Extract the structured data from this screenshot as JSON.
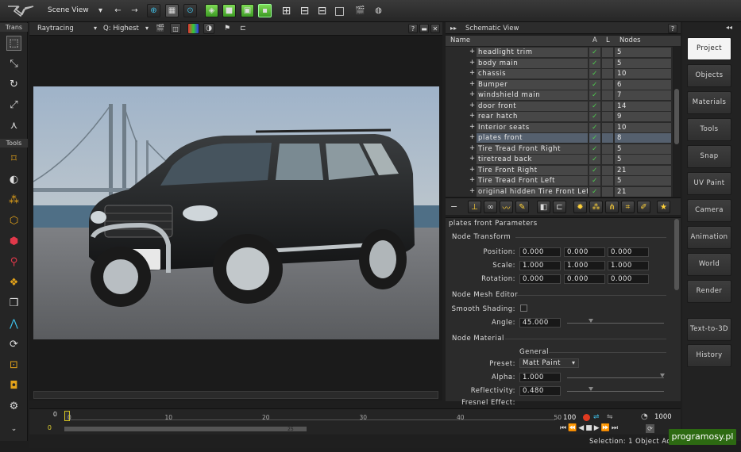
{
  "toolbar": {
    "scene_view": "Scene View"
  },
  "left_panel": {
    "trans_label": "Trans",
    "tools_label": "Tools"
  },
  "viewport": {
    "renderer": "Raytracing",
    "quality": "Q: Highest"
  },
  "schematic": {
    "title": "Schematic View",
    "columns": {
      "name": "Name",
      "a": "A",
      "l": "L",
      "nodes": "Nodes"
    },
    "rows": [
      {
        "name": "headlight trim",
        "nodes": "5"
      },
      {
        "name": "body main",
        "nodes": "5"
      },
      {
        "name": "chassis",
        "nodes": "10"
      },
      {
        "name": "Bumper",
        "nodes": "6"
      },
      {
        "name": "windshield main",
        "nodes": "7"
      },
      {
        "name": "door front",
        "nodes": "14"
      },
      {
        "name": "rear hatch",
        "nodes": "9"
      },
      {
        "name": "Interior seats",
        "nodes": "10"
      },
      {
        "name": "plates front",
        "nodes": "8",
        "selected": true
      },
      {
        "name": "Tire Tread Front Right",
        "nodes": "5"
      },
      {
        "name": "tiretread back",
        "nodes": "5"
      },
      {
        "name": "Tire Front Right",
        "nodes": "21"
      },
      {
        "name": "Tire Tread Front Left",
        "nodes": "5"
      },
      {
        "name": "original hidden Tire Front Left",
        "nodes": "21"
      }
    ],
    "check_mark": "✓",
    "expand_mark": "+"
  },
  "params": {
    "title": "plates front Parameters",
    "node_transform": "Node Transform",
    "position_label": "Position:",
    "position": [
      "0.000",
      "0.000",
      "0.000"
    ],
    "scale_label": "Scale:",
    "scale": [
      "1.000",
      "1.000",
      "1.000"
    ],
    "rotation_label": "Rotation:",
    "rotation": [
      "0.000",
      "0.000",
      "0.000"
    ],
    "mesh_editor": "Node Mesh Editor",
    "smooth_label": "Smooth Shading:",
    "angle_label": "Angle:",
    "angle": "45.000",
    "material": "Node Material",
    "general": "General",
    "preset_label": "Preset:",
    "preset": "Matt Paint",
    "alpha_label": "Alpha:",
    "alpha": "1.000",
    "reflectivity_label": "Reflectivity:",
    "reflectivity": "0.480",
    "fresnel_label": "Fresnel Effect:"
  },
  "right_tabs": [
    {
      "label": "Project",
      "active": true
    },
    {
      "label": "Objects"
    },
    {
      "label": "Materials"
    },
    {
      "label": "Tools"
    },
    {
      "label": "Snap"
    },
    {
      "label": "UV Paint"
    },
    {
      "label": "Camera"
    },
    {
      "label": "Animation"
    },
    {
      "label": "World"
    },
    {
      "label": "Render"
    },
    {
      "label": "Text-to-3D"
    },
    {
      "label": "History"
    }
  ],
  "timeline": {
    "start": "0",
    "current": "0",
    "ticks": [
      "0",
      "10",
      "20",
      "30",
      "40",
      "50"
    ],
    "end_frame": "100",
    "max_frames": "1000",
    "range_marker": "25"
  },
  "status": {
    "selection": "Selection: 1 Object Ac"
  },
  "watermark": "programosy.pl",
  "colors": {
    "accent_green": "#4ed14e",
    "selected_row": "#55606e",
    "active_tab": "#f4f4f4"
  }
}
